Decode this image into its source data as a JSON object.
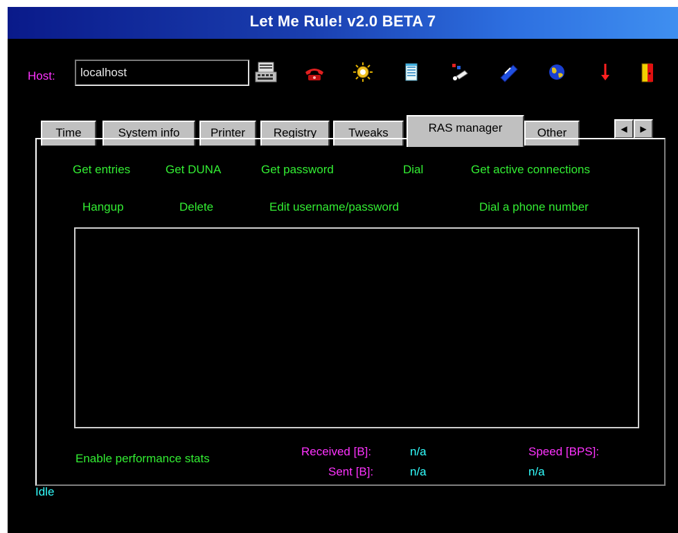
{
  "window": {
    "title": "Let Me Rule! v2.0 BETA 7"
  },
  "host": {
    "label": "Host:",
    "value": "localhost"
  },
  "toolbar": {
    "icons": [
      "keyboard-icon",
      "phone-icon",
      "sun-icon",
      "notepad-icon",
      "paint-icon",
      "pen-icon",
      "globe-icon",
      "arrow-down-icon",
      "exit-door-icon"
    ]
  },
  "tabs": {
    "items": [
      "Time",
      "System info",
      "Printer",
      "Registry",
      "Tweaks",
      "RAS manager",
      "Other"
    ],
    "active": "RAS manager",
    "scroll_left": "◀",
    "scroll_right": "▶"
  },
  "ras": {
    "actions_row1": [
      "Get entries",
      "Get DUNA",
      "Get password",
      "Dial",
      "Get active connections"
    ],
    "actions_row2": [
      "Hangup",
      "Delete",
      "Edit username/password",
      "Dial a phone number"
    ]
  },
  "stats": {
    "enable_label": "Enable performance stats",
    "received_label": "Received [B]:",
    "received_value": "n/a",
    "sent_label": "Sent [B]:",
    "sent_value": "n/a",
    "speed_label": "Speed [BPS]:",
    "speed_value": "n/a"
  },
  "status": {
    "text": "Idle"
  },
  "colors": {
    "background": "#000000",
    "accent_green": "#33ee33",
    "accent_magenta": "#ff33ff",
    "accent_cyan": "#33ffff",
    "title_gradient_start": "#0a1a8a",
    "title_gradient_end": "#3f8ff0"
  }
}
